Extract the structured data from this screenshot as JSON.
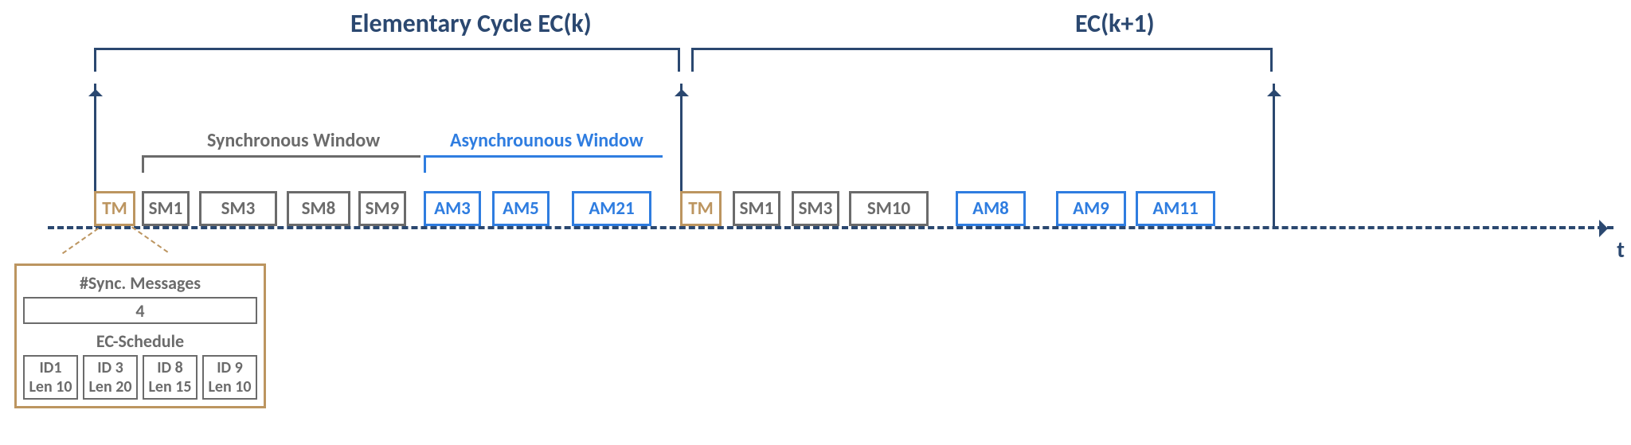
{
  "titles": {
    "ec1": "Elementary Cycle EC(k)",
    "ec2": "EC(k+1)"
  },
  "windows": {
    "sync": "Synchronous Window",
    "async": "Asynchrounous Window"
  },
  "axis_label": "t",
  "cycle1": {
    "tm": "TM",
    "sm": [
      "SM1",
      "SM3",
      "SM8",
      "SM9"
    ],
    "am": [
      "AM3",
      "AM5",
      "AM21"
    ]
  },
  "cycle2": {
    "tm": "TM",
    "sm": [
      "SM1",
      "SM3",
      "SM10"
    ],
    "am": [
      "AM8",
      "AM9",
      "AM11"
    ]
  },
  "tm_detail": {
    "sync_hdr": "#Sync. Messages",
    "sync_count": "4",
    "sched_hdr": "EC-Schedule",
    "items": [
      {
        "id": "ID1",
        "len": "Len 10"
      },
      {
        "id": "ID 3",
        "len": "Len 20"
      },
      {
        "id": "ID 8",
        "len": "Len 15"
      },
      {
        "id": "ID 9",
        "len": "Len 10"
      }
    ]
  },
  "chart_data": {
    "type": "table",
    "title": "Elementary Cycle timeline with Synchronous/Asynchronous windows",
    "cycles": [
      {
        "name": "EC(k)",
        "trigger_message": {
          "sync_message_count": 4,
          "ec_schedule": [
            {
              "id": 1,
              "len": 10
            },
            {
              "id": 3,
              "len": 20
            },
            {
              "id": 8,
              "len": 15
            },
            {
              "id": 9,
              "len": 10
            }
          ]
        },
        "synchronous_window": [
          "SM1",
          "SM3",
          "SM8",
          "SM9"
        ],
        "asynchronous_window": [
          "AM3",
          "AM5",
          "AM21"
        ]
      },
      {
        "name": "EC(k+1)",
        "synchronous_window": [
          "SM1",
          "SM3",
          "SM10"
        ],
        "asynchronous_window": [
          "AM8",
          "AM9",
          "AM11"
        ]
      }
    ]
  }
}
